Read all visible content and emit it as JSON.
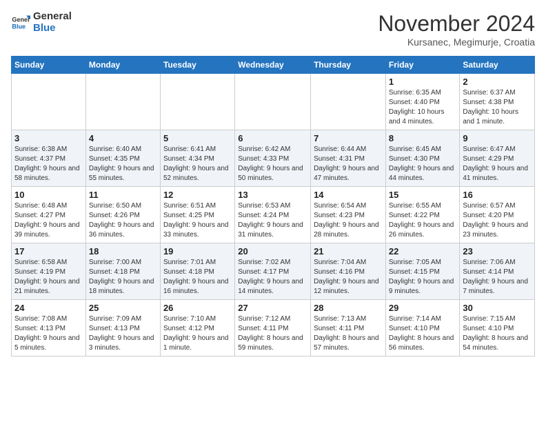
{
  "logo": {
    "line1": "General",
    "line2": "Blue"
  },
  "title": "November 2024",
  "subtitle": "Kursanec, Megimurje, Croatia",
  "weekdays": [
    "Sunday",
    "Monday",
    "Tuesday",
    "Wednesday",
    "Thursday",
    "Friday",
    "Saturday"
  ],
  "weeks": [
    [
      {
        "day": "",
        "info": ""
      },
      {
        "day": "",
        "info": ""
      },
      {
        "day": "",
        "info": ""
      },
      {
        "day": "",
        "info": ""
      },
      {
        "day": "",
        "info": ""
      },
      {
        "day": "1",
        "info": "Sunrise: 6:35 AM\nSunset: 4:40 PM\nDaylight: 10 hours and 4 minutes."
      },
      {
        "day": "2",
        "info": "Sunrise: 6:37 AM\nSunset: 4:38 PM\nDaylight: 10 hours and 1 minute."
      }
    ],
    [
      {
        "day": "3",
        "info": "Sunrise: 6:38 AM\nSunset: 4:37 PM\nDaylight: 9 hours and 58 minutes."
      },
      {
        "day": "4",
        "info": "Sunrise: 6:40 AM\nSunset: 4:35 PM\nDaylight: 9 hours and 55 minutes."
      },
      {
        "day": "5",
        "info": "Sunrise: 6:41 AM\nSunset: 4:34 PM\nDaylight: 9 hours and 52 minutes."
      },
      {
        "day": "6",
        "info": "Sunrise: 6:42 AM\nSunset: 4:33 PM\nDaylight: 9 hours and 50 minutes."
      },
      {
        "day": "7",
        "info": "Sunrise: 6:44 AM\nSunset: 4:31 PM\nDaylight: 9 hours and 47 minutes."
      },
      {
        "day": "8",
        "info": "Sunrise: 6:45 AM\nSunset: 4:30 PM\nDaylight: 9 hours and 44 minutes."
      },
      {
        "day": "9",
        "info": "Sunrise: 6:47 AM\nSunset: 4:29 PM\nDaylight: 9 hours and 41 minutes."
      }
    ],
    [
      {
        "day": "10",
        "info": "Sunrise: 6:48 AM\nSunset: 4:27 PM\nDaylight: 9 hours and 39 minutes."
      },
      {
        "day": "11",
        "info": "Sunrise: 6:50 AM\nSunset: 4:26 PM\nDaylight: 9 hours and 36 minutes."
      },
      {
        "day": "12",
        "info": "Sunrise: 6:51 AM\nSunset: 4:25 PM\nDaylight: 9 hours and 33 minutes."
      },
      {
        "day": "13",
        "info": "Sunrise: 6:53 AM\nSunset: 4:24 PM\nDaylight: 9 hours and 31 minutes."
      },
      {
        "day": "14",
        "info": "Sunrise: 6:54 AM\nSunset: 4:23 PM\nDaylight: 9 hours and 28 minutes."
      },
      {
        "day": "15",
        "info": "Sunrise: 6:55 AM\nSunset: 4:22 PM\nDaylight: 9 hours and 26 minutes."
      },
      {
        "day": "16",
        "info": "Sunrise: 6:57 AM\nSunset: 4:20 PM\nDaylight: 9 hours and 23 minutes."
      }
    ],
    [
      {
        "day": "17",
        "info": "Sunrise: 6:58 AM\nSunset: 4:19 PM\nDaylight: 9 hours and 21 minutes."
      },
      {
        "day": "18",
        "info": "Sunrise: 7:00 AM\nSunset: 4:18 PM\nDaylight: 9 hours and 18 minutes."
      },
      {
        "day": "19",
        "info": "Sunrise: 7:01 AM\nSunset: 4:18 PM\nDaylight: 9 hours and 16 minutes."
      },
      {
        "day": "20",
        "info": "Sunrise: 7:02 AM\nSunset: 4:17 PM\nDaylight: 9 hours and 14 minutes."
      },
      {
        "day": "21",
        "info": "Sunrise: 7:04 AM\nSunset: 4:16 PM\nDaylight: 9 hours and 12 minutes."
      },
      {
        "day": "22",
        "info": "Sunrise: 7:05 AM\nSunset: 4:15 PM\nDaylight: 9 hours and 9 minutes."
      },
      {
        "day": "23",
        "info": "Sunrise: 7:06 AM\nSunset: 4:14 PM\nDaylight: 9 hours and 7 minutes."
      }
    ],
    [
      {
        "day": "24",
        "info": "Sunrise: 7:08 AM\nSunset: 4:13 PM\nDaylight: 9 hours and 5 minutes."
      },
      {
        "day": "25",
        "info": "Sunrise: 7:09 AM\nSunset: 4:13 PM\nDaylight: 9 hours and 3 minutes."
      },
      {
        "day": "26",
        "info": "Sunrise: 7:10 AM\nSunset: 4:12 PM\nDaylight: 9 hours and 1 minute."
      },
      {
        "day": "27",
        "info": "Sunrise: 7:12 AM\nSunset: 4:11 PM\nDaylight: 8 hours and 59 minutes."
      },
      {
        "day": "28",
        "info": "Sunrise: 7:13 AM\nSunset: 4:11 PM\nDaylight: 8 hours and 57 minutes."
      },
      {
        "day": "29",
        "info": "Sunrise: 7:14 AM\nSunset: 4:10 PM\nDaylight: 8 hours and 56 minutes."
      },
      {
        "day": "30",
        "info": "Sunrise: 7:15 AM\nSunset: 4:10 PM\nDaylight: 8 hours and 54 minutes."
      }
    ]
  ]
}
